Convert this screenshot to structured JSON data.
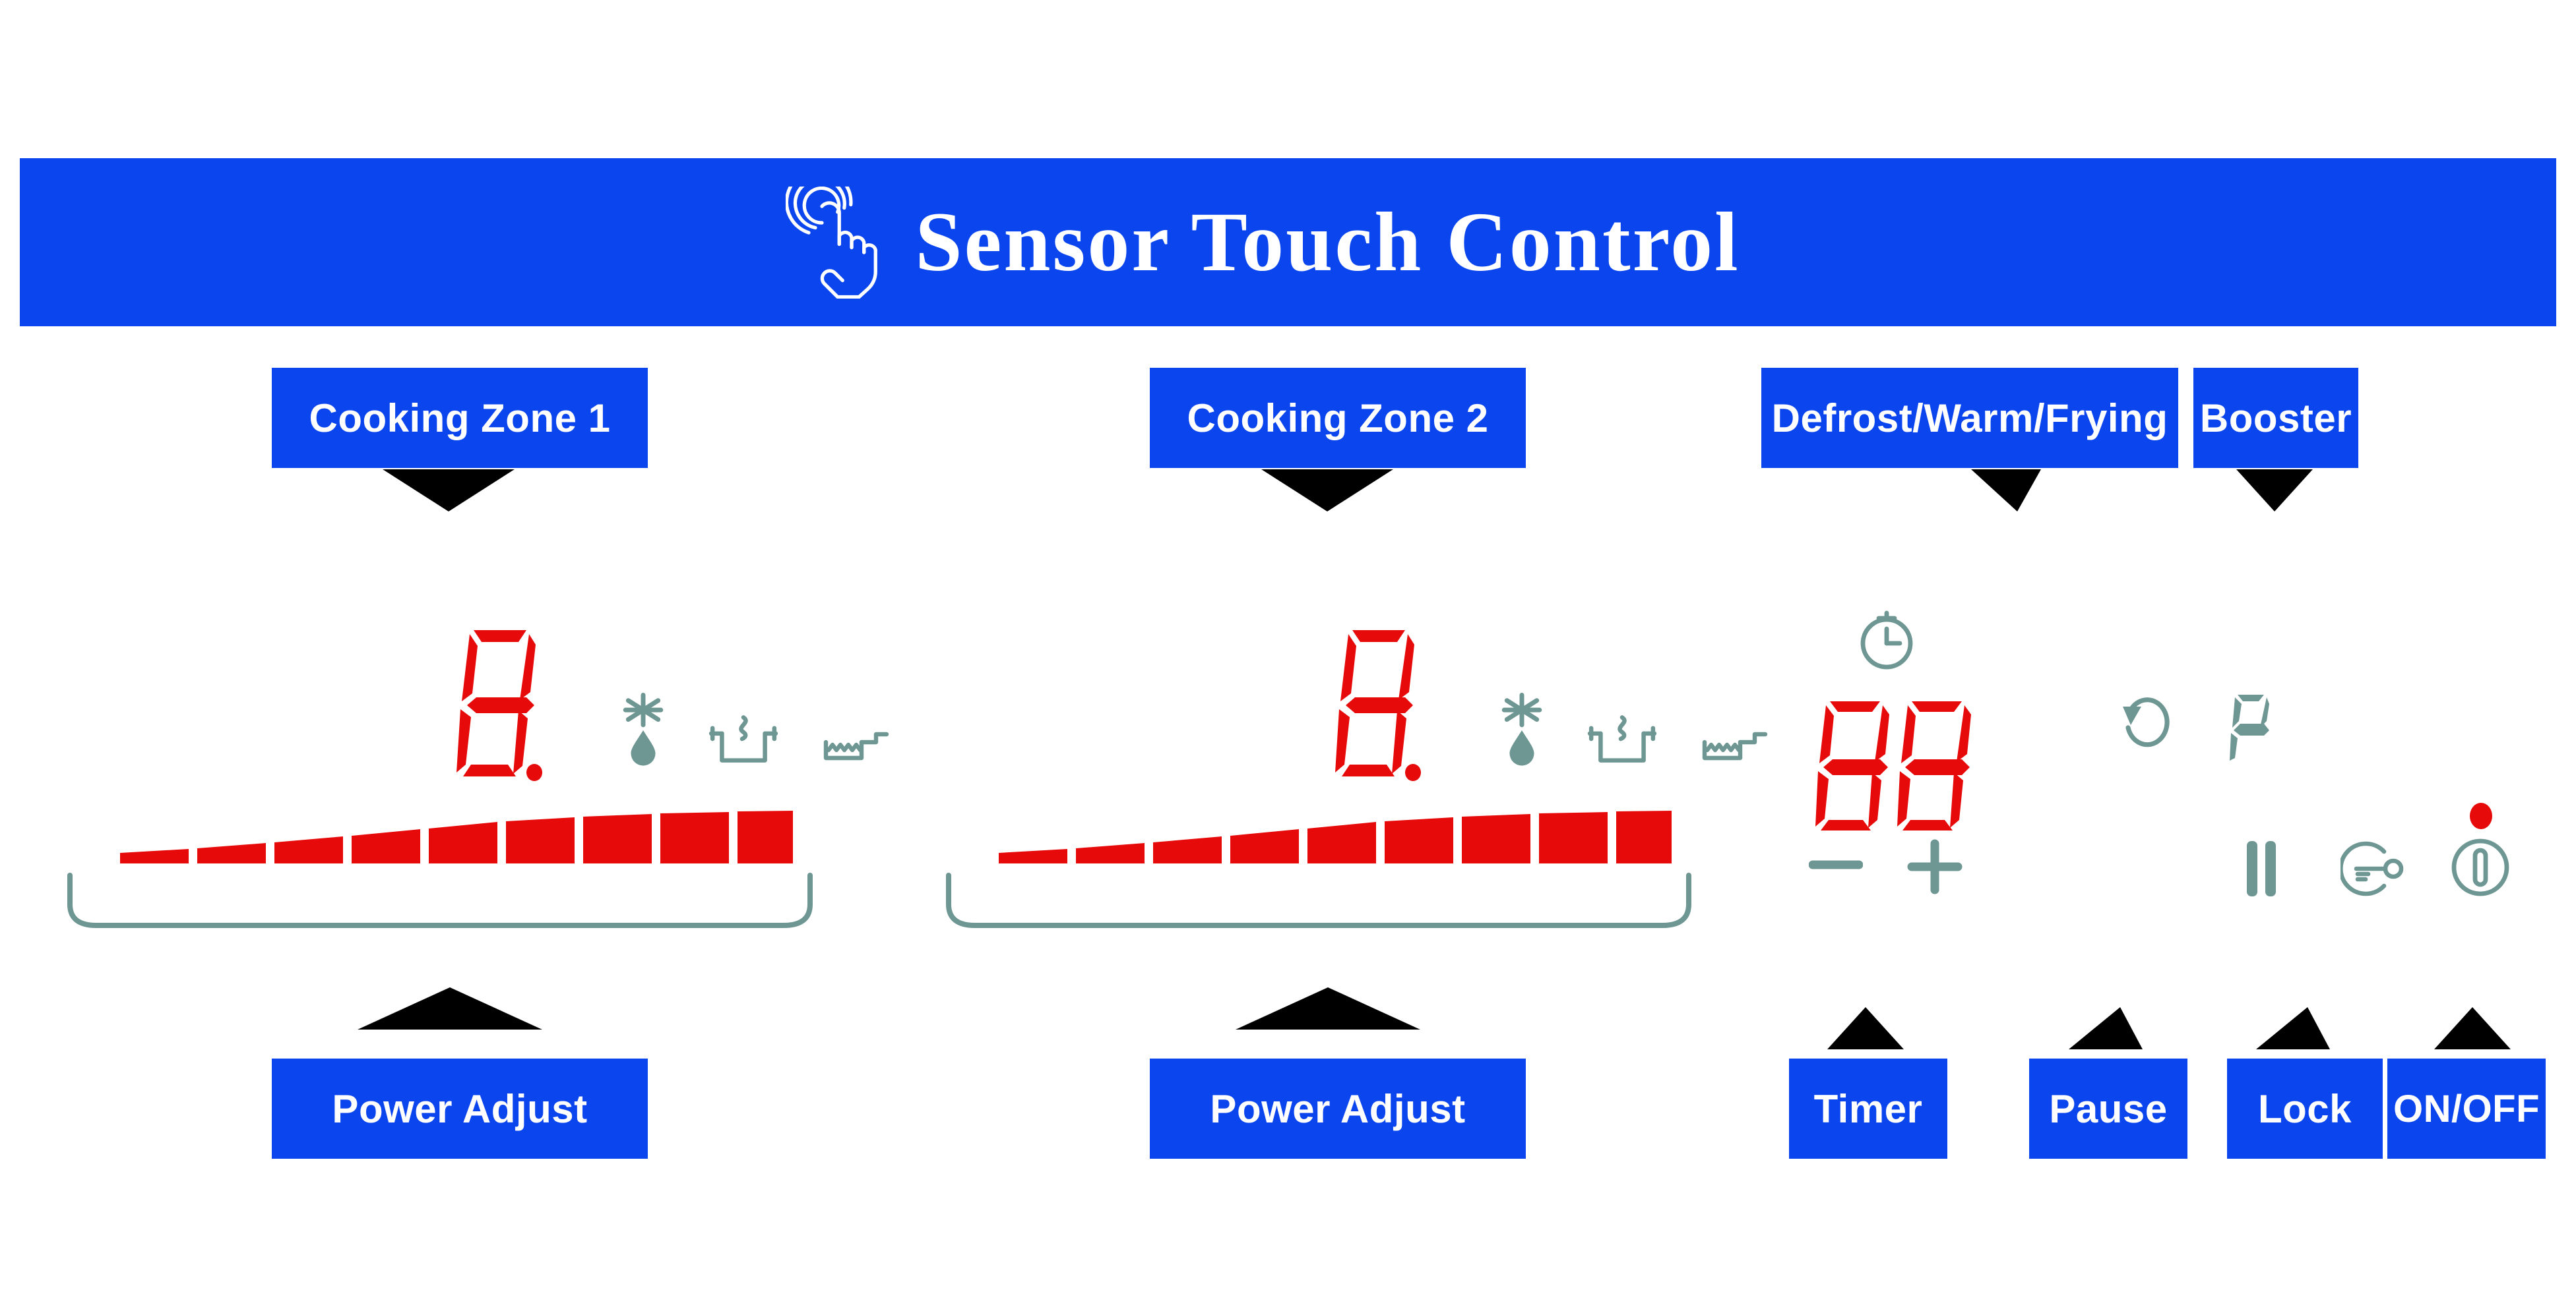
{
  "page": {
    "background": "#FFFFFF",
    "blue": "#0B45EE",
    "red": "#E60A0A",
    "teal": "#6E9793",
    "black": "#000000"
  },
  "banner": {
    "title": "Sensor Touch Control",
    "icon": "touch-hand-icon"
  },
  "top_labels": [
    {
      "key": "cooking_zone_1",
      "label": "Cooking Zone 1"
    },
    {
      "key": "cooking_zone_2",
      "label": "Cooking Zone 2"
    },
    {
      "key": "defrost_warm_frying",
      "label": "Defrost/Warm/Frying"
    },
    {
      "key": "booster",
      "label": "Booster"
    }
  ],
  "bottom_labels": [
    {
      "key": "power_adjust_1",
      "label": "Power Adjust"
    },
    {
      "key": "power_adjust_2",
      "label": "Power Adjust"
    },
    {
      "key": "timer",
      "label": "Timer"
    },
    {
      "key": "pause",
      "label": "Pause"
    },
    {
      "key": "lock",
      "label": "Lock"
    },
    {
      "key": "on_off",
      "label": "ON/OFF"
    }
  ],
  "zones": [
    {
      "key": "zone_1",
      "display_value": "8",
      "display_decimal": ".",
      "slider_segments": 9,
      "function_icons": [
        {
          "name": "defrost-icon",
          "title": "Defrost"
        },
        {
          "name": "keep-warm-pot-icon",
          "title": "Keep Warm"
        },
        {
          "name": "frying-pan-icon",
          "title": "Frying"
        }
      ]
    },
    {
      "key": "zone_2",
      "display_value": "8",
      "display_decimal": ".",
      "slider_segments": 9,
      "function_icons": [
        {
          "name": "defrost-icon",
          "title": "Defrost"
        },
        {
          "name": "keep-warm-pot-icon",
          "title": "Keep Warm"
        },
        {
          "name": "frying-pan-icon",
          "title": "Frying"
        }
      ]
    }
  ],
  "controls": {
    "timer_display_value": "88",
    "timer_clock_icon": "stopwatch-icon",
    "minus_label": "−",
    "plus_label": "+",
    "loop_icon": "circular-arrow-icon",
    "pause_indicator_value": "P",
    "pause_icon": "pause-bars-icon",
    "lock_icon": "key-lock-icon",
    "power_icon": "power-button-icon",
    "power_dot": "power-indicator-dot"
  }
}
